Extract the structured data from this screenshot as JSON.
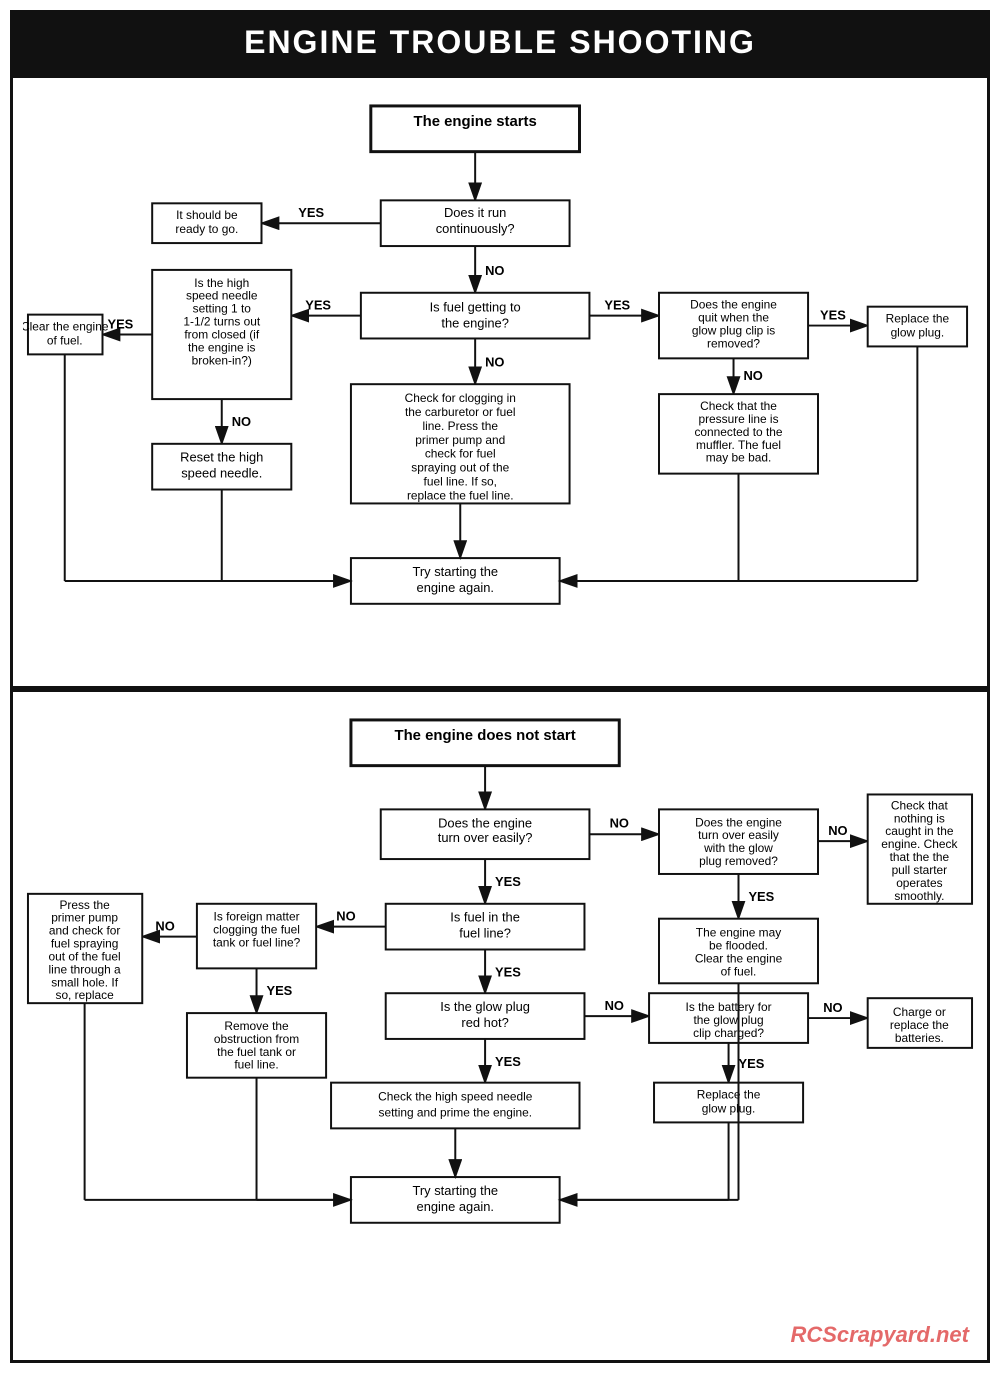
{
  "title": "ENGINE TROUBLE SHOOTING",
  "section1": {
    "start_node": "The engine starts",
    "nodes": {
      "engine_starts": "The engine starts",
      "run_continuously": "Does it run continuously?",
      "ready_to_go": "It should be ready to go.",
      "high_speed_needle": "Is the high speed needle setting 1 to 1-1/2 turns out from closed (if the engine is broken-in?)",
      "clear_engine": "Clear the engine of fuel.",
      "reset_needle": "Reset the high speed needle.",
      "fuel_getting": "Is fuel getting to the engine?",
      "check_clogging": "Check for clogging in the carburetor or fuel line. Press the primer pump and check for fuel spraying out of the fuel line. If so, replace the fuel line.",
      "does_engine_quit": "Does the engine quit when the glow plug clip is removed?",
      "replace_glow_plug1": "Replace the glow plug.",
      "check_pressure_line": "Check that the pressure line is connected to the muffler. The fuel may be bad.",
      "try_starting1": "Try starting the engine again."
    },
    "labels": {
      "yes": "YES",
      "no": "NO"
    }
  },
  "section2": {
    "start_node": "The engine does not start",
    "nodes": {
      "engine_no_start": "The engine does not start",
      "turn_over": "Does the engine turn over easily?",
      "turn_over_no_glow": "Does the engine turn over easily with the glow plug removed?",
      "check_nothing_caught": "Check that nothing is caught in the engine. Check that the the pull starter operates smoothly.",
      "press_primer": "Press the primer pump and check for fuel spraying out of the fuel line through a small hole. If so, replace the fuel line.",
      "foreign_matter": "Is foreign matter clogging the fuel tank or fuel line?",
      "fuel_in_line": "Is fuel in the fuel line?",
      "engine_flooded": "The engine may be flooded. Clear the engine of fuel.",
      "remove_obstruction": "Remove the obstruction from the fuel tank or fuel line.",
      "glow_plug_red_hot": "Is the glow plug red hot?",
      "battery_charged": "Is the battery for the glow plug clip charged?",
      "charge_replace": "Charge or replace the batteries.",
      "check_high_speed": "Check the high speed needle setting and prime the engine.",
      "replace_glow_plug2": "Replace the glow plug.",
      "try_starting2": "Try starting the engine again."
    },
    "labels": {
      "yes": "YES",
      "no": "NO"
    }
  },
  "watermark": "RCScrapyard.net"
}
